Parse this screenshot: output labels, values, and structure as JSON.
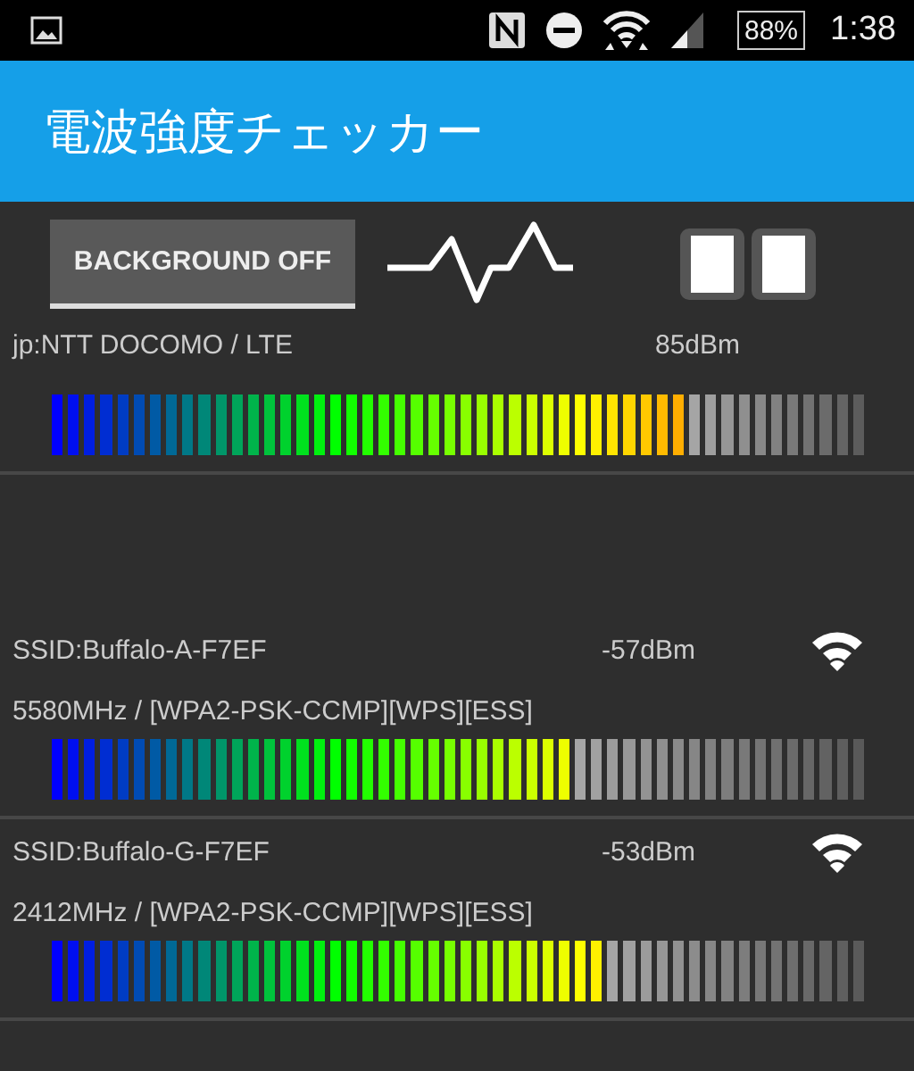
{
  "status_bar": {
    "battery": "88%",
    "time": "1:38"
  },
  "app_bar": {
    "title": "電波強度チェッカー"
  },
  "toolbar": {
    "button": "BACKGROUND OFF"
  },
  "cellular": {
    "name": "jp:NTT DOCOMO / LTE",
    "reading": "85dBm"
  },
  "wifi_networks": [
    {
      "ssid": "SSID:Buffalo-A-F7EF",
      "reading": "-57dBm",
      "details": "5580MHz / [WPA2-PSK-CCMP][WPS][ESS]"
    },
    {
      "ssid": "SSID:Buffalo-G-F7EF",
      "reading": "-53dBm",
      "details": "2412MHz / [WPA2-PSK-CCMP][WPS][ESS]"
    }
  ]
}
